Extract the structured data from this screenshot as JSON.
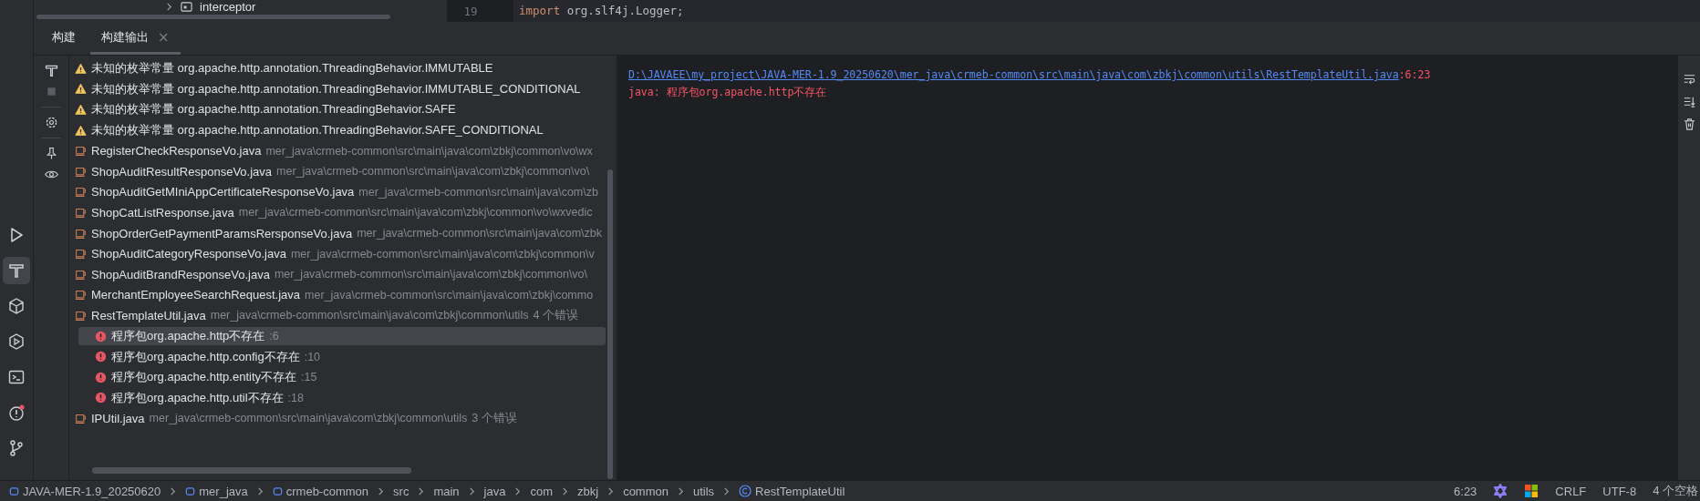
{
  "project_tree": {
    "item": "interceptor"
  },
  "editor": {
    "line_number": "19",
    "keyword": "import",
    "code": "org.slf4j.Logger;"
  },
  "tabs": [
    {
      "label": "构建",
      "selected": false
    },
    {
      "label": "构建输出",
      "selected": true,
      "close": "×"
    }
  ],
  "build_tree": [
    {
      "kind": "warning",
      "text": "未知的枚举常量 org.apache.http.annotation.ThreadingBehavior.IMMUTABLE",
      "selected": false
    },
    {
      "kind": "warning",
      "text": "未知的枚举常量 org.apache.http.annotation.ThreadingBehavior.IMMUTABLE_CONDITIONAL",
      "selected": false
    },
    {
      "kind": "warning",
      "text": "未知的枚举常量 org.apache.http.annotation.ThreadingBehavior.SAFE",
      "selected": false
    },
    {
      "kind": "warning",
      "text": "未知的枚举常量 org.apache.http.annotation.ThreadingBehavior.SAFE_CONDITIONAL",
      "selected": false
    },
    {
      "kind": "file",
      "text": "RegisterCheckResponseVo.java",
      "path": "mer_java\\crmeb-common\\src\\main\\java\\com\\zbkj\\common\\vo\\wx",
      "selected": false
    },
    {
      "kind": "file",
      "text": "ShopAuditResultResponseVo.java",
      "path": "mer_java\\crmeb-common\\src\\main\\java\\com\\zbkj\\common\\vo\\",
      "selected": false
    },
    {
      "kind": "file",
      "text": "ShopAuditGetMIniAppCertificateResponseVo.java",
      "path": "mer_java\\crmeb-common\\src\\main\\java\\com\\zb",
      "selected": false
    },
    {
      "kind": "file",
      "text": "ShopCatListResponse.java",
      "path": "mer_java\\crmeb-common\\src\\main\\java\\com\\zbkj\\common\\vo\\wxvedic",
      "selected": false
    },
    {
      "kind": "file",
      "text": "ShopOrderGetPaymentParamsRersponseVo.java",
      "path": "mer_java\\crmeb-common\\src\\main\\java\\com\\zbk",
      "selected": false
    },
    {
      "kind": "file",
      "text": "ShopAuditCategoryResponseVo.java",
      "path": "mer_java\\crmeb-common\\src\\main\\java\\com\\zbkj\\common\\v",
      "selected": false
    },
    {
      "kind": "file",
      "text": "ShopAuditBrandResponseVo.java",
      "path": "mer_java\\crmeb-common\\src\\main\\java\\com\\zbkj\\common\\vo\\",
      "selected": false
    },
    {
      "kind": "file",
      "text": "MerchantEmployeeSearchRequest.java",
      "path": "mer_java\\crmeb-common\\src\\main\\java\\com\\zbkj\\commo",
      "selected": false
    },
    {
      "kind": "file",
      "text": "RestTemplateUtil.java",
      "path": "mer_java\\crmeb-common\\src\\main\\java\\com\\zbkj\\common\\utils",
      "count": "4 个错误",
      "selected": false,
      "children": [
        {
          "kind": "error",
          "text": "程序包org.apache.http不存在",
          "line": ":6",
          "selected": true
        },
        {
          "kind": "error",
          "text": "程序包org.apache.http.config不存在",
          "line": ":10",
          "selected": false
        },
        {
          "kind": "error",
          "text": "程序包org.apache.http.entity不存在",
          "line": ":15",
          "selected": false
        },
        {
          "kind": "error",
          "text": "程序包org.apache.http.util不存在",
          "line": ":18",
          "selected": false
        }
      ]
    },
    {
      "kind": "file",
      "text": "IPUtil.java",
      "path": "mer_java\\crmeb-common\\src\\main\\java\\com\\zbkj\\common\\utils",
      "count": "3 个错误",
      "selected": false
    }
  ],
  "console": {
    "link": "D:\\JAVAEE\\my_project\\JAVA-MER-1.9_20250620\\mer_java\\crmeb-common\\src\\main\\java\\com\\zbkj\\common\\utils\\RestTemplateUtil.java",
    "position": ":6:23",
    "message": "java: 程序包org.apache.http不存在"
  },
  "status_bar": {
    "breadcrumbs": [
      {
        "kind": "module",
        "label": "JAVA-MER-1.9_20250620"
      },
      {
        "kind": "module",
        "label": "mer_java"
      },
      {
        "kind": "module",
        "label": "crmeb-common"
      },
      {
        "kind": "folder",
        "label": "src"
      },
      {
        "kind": "folder",
        "label": "main"
      },
      {
        "kind": "folder",
        "label": "java"
      },
      {
        "kind": "folder",
        "label": "com"
      },
      {
        "kind": "folder",
        "label": "zbkj"
      },
      {
        "kind": "folder",
        "label": "common"
      },
      {
        "kind": "folder",
        "label": "utils"
      },
      {
        "kind": "class",
        "label": "RestTemplateUtil"
      }
    ],
    "caret": "6:23",
    "line_separator": "CRLF",
    "encoding": "UTF-8",
    "indent": "4 个空格"
  }
}
